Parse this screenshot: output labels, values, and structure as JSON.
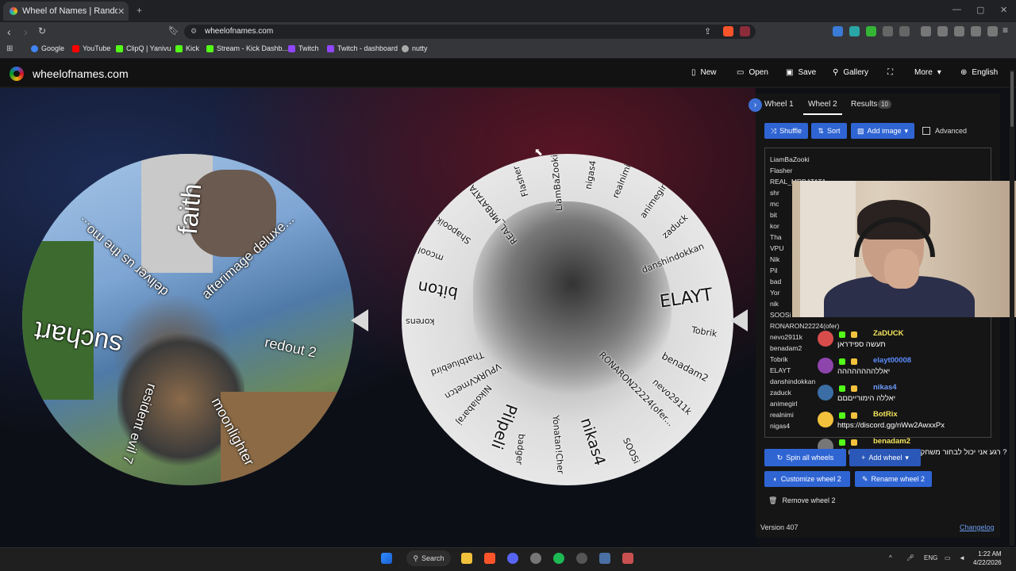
{
  "browser": {
    "tab_title": "Wheel of Names | Random name...",
    "url": "wheelofnames.com",
    "bookmarks": [
      "Google",
      "YouTube",
      "ClipQ | Yanivu",
      "Kick",
      "Stream - Kick Dashb...",
      "Twitch",
      "Twitch - dashboard",
      "nutty"
    ]
  },
  "header": {
    "site_name": "wheelofnames.com",
    "buttons": {
      "new": "New",
      "open": "Open",
      "save": "Save",
      "gallery": "Gallery",
      "more": "More",
      "language": "English"
    }
  },
  "wheel1": {
    "labels": [
      "faith",
      "afterimage deluxe...",
      "deliver us the mo...",
      "redout 2",
      "suchart",
      "moonlighter",
      "resident evil 7"
    ]
  },
  "wheel2": {
    "labels": [
      "ELAYT",
      "Tobrik",
      "benadam2",
      "nevo2911k",
      "RONARON22224(ofer...",
      "SOOSi",
      "nikas4",
      "Yonatan!Cher",
      "badger",
      "Pilpeli",
      "Nikolabaraj",
      "VPURKVmetcn",
      "Thatbluebird",
      "korens",
      "biton",
      "mcool",
      "Shapooik",
      "REAL_MRBATATA",
      "Flasher",
      "LiamBaZooki",
      "nigas4",
      "realnimi",
      "animegirl",
      "zaduck",
      "danshindokkan"
    ]
  },
  "panel": {
    "tabs": {
      "wheel1": "Wheel 1",
      "wheel2": "Wheel 2",
      "results": "Results",
      "results_count": "10"
    },
    "toolbar": {
      "shuffle": "Shuffle",
      "sort": "Sort",
      "add_image": "Add image",
      "advanced": "Advanced"
    },
    "entries": [
      "LiamBaZooki",
      "Flasher",
      "REAL_MRBATATA",
      "shr",
      "mc",
      "bit",
      "kor",
      "Tha",
      "VPU",
      "Nik",
      "Pil",
      "bad",
      "Yor",
      "nik",
      "SOOSi",
      "RONARON22224(ofer)",
      "nevo2911k",
      "benadam2",
      "Tobrik",
      "ELAYT",
      "danshindokkan",
      "zaduck",
      "animegirl",
      "realnimi",
      "nigas4"
    ],
    "buttons": {
      "spin_all": "Spin all wheels",
      "add_wheel": "Add wheel",
      "customize": "Customize wheel 2",
      "rename": "Rename wheel 2",
      "remove": "Remove wheel 2"
    },
    "version": "Version 407",
    "changelog": "Changelog"
  },
  "chat": [
    {
      "user": "ZaDUCK",
      "message": "תעשה ספידראן",
      "color": "#f4e45a"
    },
    {
      "user": "elayt00008",
      "message": "יאללהההההההה",
      "color": "#5b8cff"
    },
    {
      "user": "nikas4",
      "message": "יאללה הימורייםםם",
      "color": "#6e9cff"
    },
    {
      "user": "BotRix",
      "message": "https://discord.gg/nWw2AwxxPx",
      "color": "#f4e45a"
    },
    {
      "user": "benadam2",
      "message": "רגע אני יכול לבחור משחק כי הבאתי את המשקים לא ?",
      "color": "#f4e45a"
    }
  ],
  "taskbar": {
    "search": "Search",
    "lang": "ENG",
    "time": "1:22 AM",
    "date": "4/22/2026"
  },
  "colors": {
    "accent": "#2f64d3",
    "panel_bg": "#151515",
    "header_bg": "#121212"
  }
}
